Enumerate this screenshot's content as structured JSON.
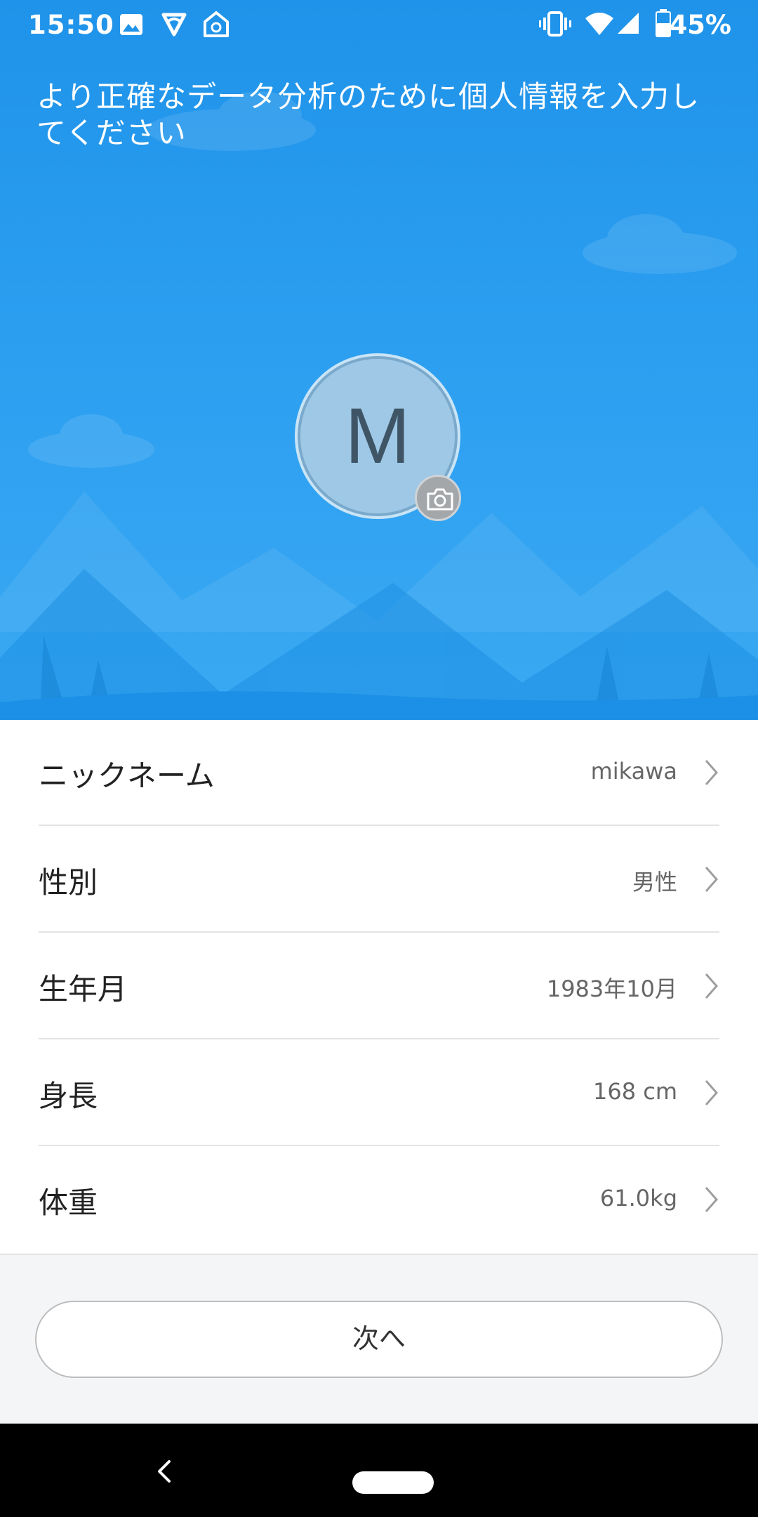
{
  "status_bar": {
    "time": "15:50",
    "battery": "45%",
    "icons": [
      "image-icon",
      "swiftkey-icon",
      "home-shield-icon",
      "vibrate-icon",
      "wifi-icon",
      "cell-signal-icon",
      "battery-icon"
    ]
  },
  "hero": {
    "title": "より正確なデータ分析のために個人情報を入力してください",
    "avatar_letter": "M",
    "colors": {
      "sky_top": "#1f93e9",
      "sky_bottom": "#3aa9f3",
      "avatar_bg": "#9ec8e6"
    }
  },
  "profile": {
    "rows": [
      {
        "label": "ニックネーム",
        "value": "mikawa"
      },
      {
        "label": "性別",
        "value": "男性"
      },
      {
        "label": "生年月",
        "value": "1983年10月"
      },
      {
        "label": "身長",
        "value": "168 cm"
      },
      {
        "label": "体重",
        "value": "61.0kg"
      }
    ]
  },
  "footer": {
    "next_label": "次へ"
  },
  "nav": {
    "icons": [
      "back-icon",
      "home-pill-icon"
    ]
  }
}
